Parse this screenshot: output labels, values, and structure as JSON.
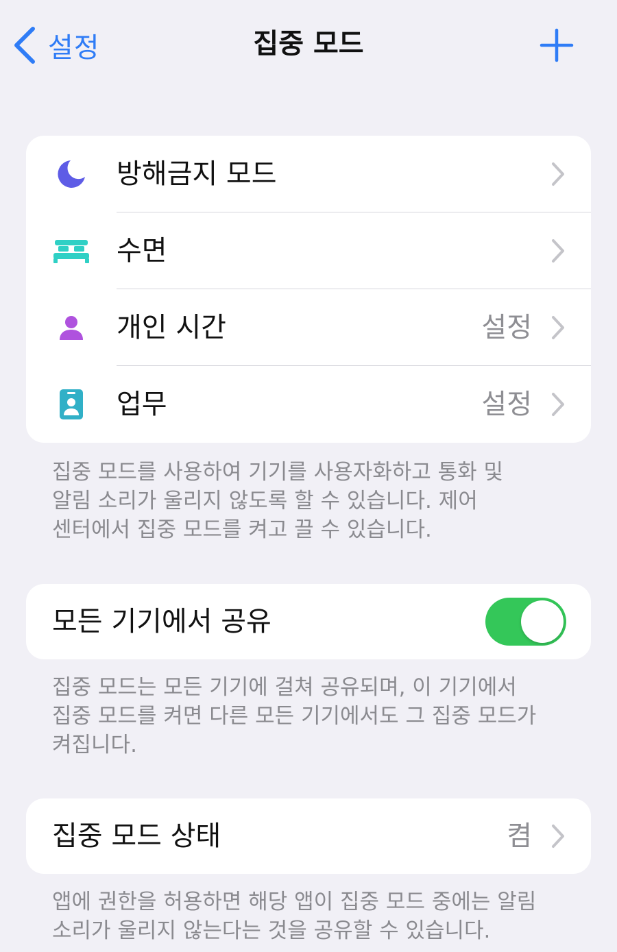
{
  "nav": {
    "back_label": "설정",
    "title": "집중 모드"
  },
  "focus_list": {
    "items": [
      {
        "label": "방해금지 모드",
        "icon": "moon-icon",
        "color": "#5e5ce6",
        "value": ""
      },
      {
        "label": "수면",
        "icon": "bed-icon",
        "color": "#2fd0c5",
        "value": ""
      },
      {
        "label": "개인 시간",
        "icon": "person-icon",
        "color": "#af52de",
        "value": "설정"
      },
      {
        "label": "업무",
        "icon": "id-badge-icon",
        "color": "#30b0c7",
        "value": "설정"
      }
    ],
    "footer_lines": [
      "집중 모드를 사용하여 기기를 사용자화하고 통화 및",
      "알림 소리가 울리지 않도록 할 수 있습니다. 제어",
      "센터에서 집중 모드를 켜고 끌 수 있습니다."
    ]
  },
  "share": {
    "label": "모든 기기에서 공유",
    "toggle_on": true,
    "footer_lines": [
      "집중 모드는 모든 기기에 걸쳐 공유되며, 이 기기에서",
      "집중 모드를 켜면 다른 모든 기기에서도 그 집중 모드가",
      "켜집니다."
    ]
  },
  "status": {
    "label": "집중 모드 상태",
    "value": "켬",
    "footer_lines": [
      "앱에 권한을 허용하면 해당 앱이 집중 모드 중에는 알림",
      "소리가 울리지 않는다는 것을 공유할 수 있습니다."
    ]
  },
  "colors": {
    "accent": "#2f7cf6",
    "toggle_on": "#34c759",
    "background": "#f1f0f6"
  }
}
